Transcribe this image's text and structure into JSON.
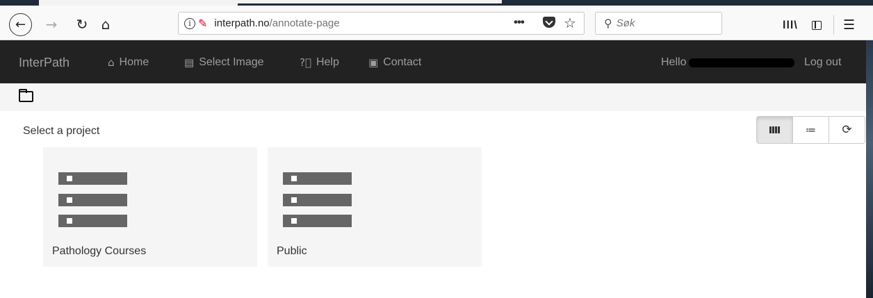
{
  "browser": {
    "url_domain": "interpath.no",
    "url_path": "/annotate-page",
    "search_placeholder": "Søk",
    "icons": [
      "back-icon",
      "forward-icon",
      "reload-icon",
      "home-icon",
      "info-icon",
      "insecure-icon",
      "page-actions-icon",
      "pocket-icon",
      "bookmark-star-icon",
      "search-icon",
      "library-icon",
      "sidebar-icon",
      "menu-icon"
    ]
  },
  "navbar": {
    "brand": "InterPath",
    "items": [
      {
        "label": "Home",
        "icon": "home-icon"
      },
      {
        "label": "Select Image",
        "icon": "message-icon"
      },
      {
        "label": "Help",
        "icon": "help-icon"
      },
      {
        "label": "Contact",
        "icon": "contact-card-icon"
      }
    ],
    "greeting": "Hello",
    "logout": "Log out"
  },
  "main": {
    "select_label": "Select a project",
    "view_buttons": [
      "grid-view-icon",
      "list-view-icon",
      "refresh-icon"
    ],
    "projects": [
      {
        "name": "Pathology Courses",
        "icon": "server-icon"
      },
      {
        "name": "Public",
        "icon": "server-icon"
      }
    ]
  },
  "colors": {
    "navbar_bg": "#222222",
    "navbar_text": "#9d9d9d",
    "card_bg": "#f5f5f5",
    "server_icon": "#666666"
  }
}
